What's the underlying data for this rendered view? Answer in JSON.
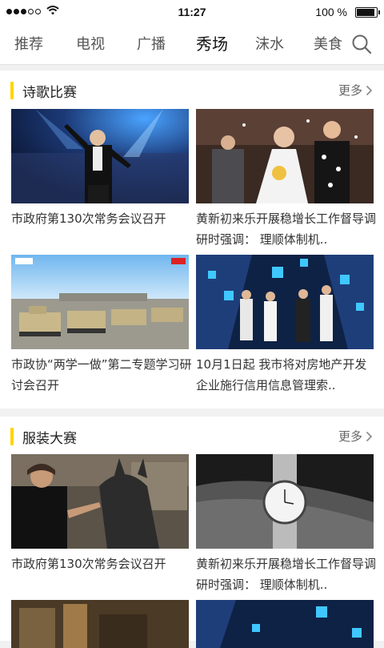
{
  "status_bar": {
    "time": "11:27",
    "battery": "100 %"
  },
  "nav": {
    "tabs": [
      {
        "label": "推荐"
      },
      {
        "label": "电视"
      },
      {
        "label": "广播"
      },
      {
        "label": "秀场",
        "active": true
      },
      {
        "label": "沫水"
      },
      {
        "label": "美食"
      }
    ],
    "search_icon": "search-icon"
  },
  "sections": [
    {
      "title": "诗歌比赛",
      "more": "更多",
      "cards": [
        {
          "caption": "市政府第130次常务会议召开"
        },
        {
          "caption": "黄新初来乐开展稳增长工作督导调研时强调：  理顺体制机.."
        },
        {
          "caption": "市政协“两学一做”第二专题学习研讨会召开"
        },
        {
          "caption": "10月1日起 我市将对房地产开发企业施行信用信息管理索.."
        }
      ]
    },
    {
      "title": "服装大赛",
      "more": "更多",
      "cards": [
        {
          "caption": "市政府第130次常务会议召开"
        },
        {
          "caption": "黄新初来乐开展稳增长工作督导调研时强调：  理顺体制机.."
        }
      ]
    }
  ],
  "colors": {
    "accent_bar": "#ffd400",
    "background": "#f1f1f1"
  }
}
